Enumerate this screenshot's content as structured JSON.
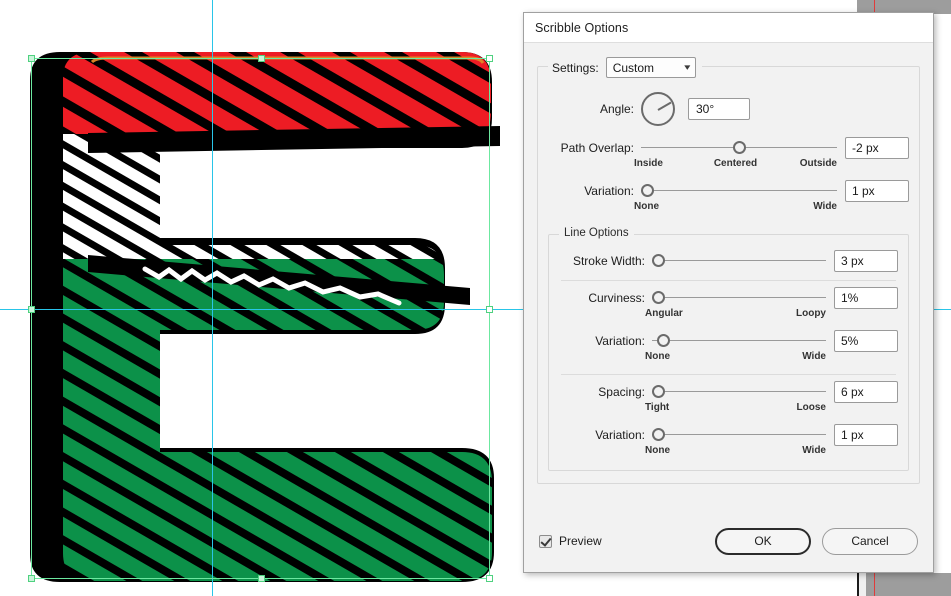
{
  "dialog": {
    "title": "Scribble Options",
    "settings": {
      "label": "Settings:",
      "value": "Custom",
      "caret": "chevron-down-icon"
    },
    "angle": {
      "label": "Angle:",
      "value": "30°",
      "degrees": 30
    },
    "path_overlap": {
      "label": "Path Overlap:",
      "value": "-2 px",
      "thumb_pct": 50,
      "end_left": "Inside",
      "end_mid": "Centered",
      "end_right": "Outside"
    },
    "overlap_variation": {
      "label": "Variation:",
      "value": "1 px",
      "thumb_pct": 0,
      "end_left": "None",
      "end_right": "Wide"
    },
    "line_options": {
      "legend": "Line Options",
      "stroke_width": {
        "label": "Stroke Width:",
        "value": "3 px",
        "thumb_pct": 0
      },
      "curviness": {
        "label": "Curviness:",
        "value": "1%",
        "thumb_pct": 0,
        "end_left": "Angular",
        "end_right": "Loopy"
      },
      "curviness_variation": {
        "label": "Variation:",
        "value": "5%",
        "thumb_pct": 1,
        "end_left": "None",
        "end_right": "Wide"
      },
      "spacing": {
        "label": "Spacing:",
        "value": "6 px",
        "thumb_pct": 0,
        "end_left": "Tight",
        "end_right": "Loose"
      },
      "spacing_variation": {
        "label": "Variation:",
        "value": "1 px",
        "thumb_pct": 0,
        "end_left": "None",
        "end_right": "Wide"
      }
    },
    "footer": {
      "preview_label": "Preview",
      "preview_checked": true,
      "ok_label": "OK",
      "cancel_label": "Cancel"
    }
  },
  "canvas": {
    "artwork_name": "letter-e-scribble",
    "colors": {
      "red": "#ED1C24",
      "green": "#0C9149",
      "white": "#FFFFFF",
      "outline": "#000000",
      "guide": "#29c5e8",
      "selection": "#6ce8a0",
      "accent_orange": "#E08A28"
    }
  }
}
